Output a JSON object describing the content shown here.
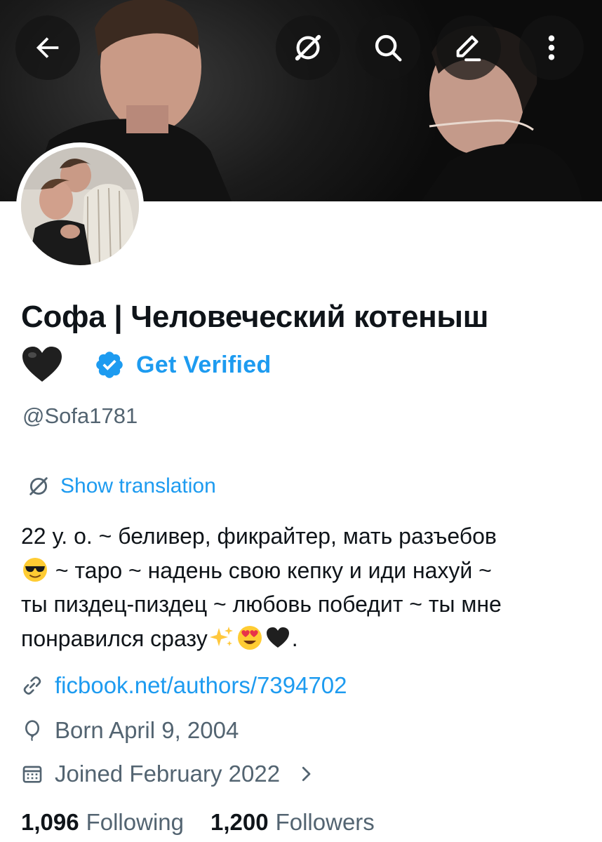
{
  "header": {
    "icons": {
      "back": "arrow-left-icon",
      "translate": "no-translate-icon",
      "search": "search-icon",
      "edit": "edit-icon",
      "more": "more-vertical-icon"
    }
  },
  "profile": {
    "display_name": "Софа | Человеческий котеныш",
    "name_emoji": "black-heart-emoji",
    "get_verified_label": "Get Verified",
    "handle": "@Sofa1781",
    "show_translation_label": "Show translation",
    "bio": {
      "line1": "22 у. о. ~ беливер, фикрайтер, мать разъебов",
      "line2_after_emoji": " ~ таро ~ надень свою кепку и иди нахуй ~",
      "line3": "ты пиздец-пиздец ~ любовь победит ~ ты мне",
      "line4_before_emoji": "понравился сразу",
      "line4_end": "."
    },
    "website": "ficbook.net/authors/7394702",
    "birthday": "Born April 9, 2004",
    "joined": "Joined February 2022",
    "following_count": "1,096",
    "following_label": "Following",
    "followers_count": "1,200",
    "followers_label": "Followers"
  },
  "colors": {
    "accent": "#1d9bf0",
    "secondary_text": "#536471",
    "primary_text": "#0f1419"
  }
}
